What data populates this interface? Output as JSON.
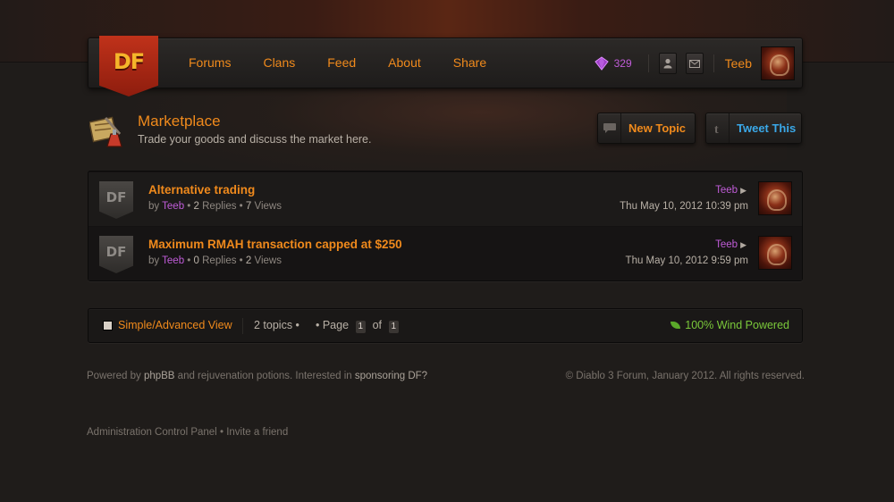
{
  "nav": {
    "logo_text": "DF",
    "links": [
      "Forums",
      "Clans",
      "Feed",
      "About",
      "Share"
    ],
    "gem_count": "329",
    "user_name": "Teeb"
  },
  "forum": {
    "title": "Marketplace",
    "description": "Trade your goods and discuss the market here.",
    "new_topic_label": "New Topic",
    "tweet_label": "Tweet This"
  },
  "topics": [
    {
      "badge": "DF",
      "title": "Alternative trading",
      "by": "by",
      "author": "Teeb",
      "replies": "2",
      "replies_label": "Replies",
      "views": "7",
      "views_label": "Views",
      "last_poster": "Teeb",
      "last_date": "Thu May 10, 2012 10:39 pm"
    },
    {
      "badge": "DF",
      "title": "Maximum RMAH transaction capped at $250",
      "by": "by",
      "author": "Teeb",
      "replies": "0",
      "replies_label": "Replies",
      "views": "2",
      "views_label": "Views",
      "last_poster": "Teeb",
      "last_date": "Thu May 10, 2012 9:59 pm"
    }
  ],
  "pagebar": {
    "view_label": "Simple/Advanced View",
    "topic_count": "2 topics •",
    "page_prefix": "• Page",
    "current_page": "1",
    "of_label": "of",
    "total_pages": "1",
    "wind_label": "100% Wind Powered"
  },
  "footer": {
    "powered_prefix": "Powered by",
    "powered_phpbb": "phpBB",
    "powered_mid": "and rejuvenation potions. Interested in",
    "powered_sponsor": "sponsoring DF?",
    "copyright": "© Diablo 3 Forum, January 2012. All rights reserved.",
    "admin_link": "Administration Control Panel",
    "bullet": "•",
    "invite_link": "Invite a friend"
  },
  "colors": {
    "accent_orange": "#f08a1c",
    "username_purple": "#c05cd8",
    "tweet_blue": "#3aa8e8",
    "wind_green": "#7ac83a"
  }
}
